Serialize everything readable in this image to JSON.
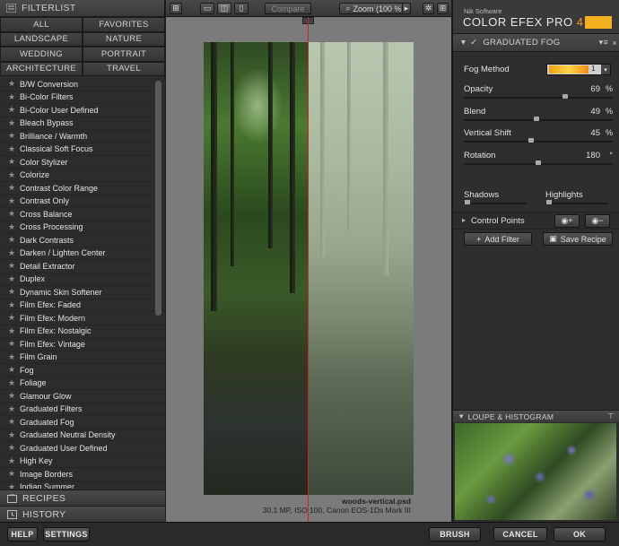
{
  "left_panel": {
    "title": "FILTERLIST",
    "categories": [
      "ALL",
      "FAVORITES",
      "LANDSCAPE",
      "NATURE",
      "WEDDING",
      "PORTRAIT",
      "ARCHITECTURE",
      "TRAVEL"
    ],
    "filters": [
      "B/W Conversion",
      "Bi-Color Filters",
      "Bi-Color User Defined",
      "Bleach Bypass",
      "Brilliance / Warmth",
      "Classical Soft Focus",
      "Color Stylizer",
      "Colorize",
      "Contrast Color Range",
      "Contrast Only",
      "Cross Balance",
      "Cross Processing",
      "Dark Contrasts",
      "Darken / Lighten Center",
      "Detail Extractor",
      "Duplex",
      "Dynamic Skin Softener",
      "Film Efex: Faded",
      "Film Efex: Modern",
      "Film Efex: Nostalgic",
      "Film Efex: Vintage",
      "Film Grain",
      "Fog",
      "Foliage",
      "Glamour Glow",
      "Graduated Filters",
      "Graduated Fog",
      "Graduated Neutral Density",
      "Graduated User Defined",
      "High Key",
      "Image Borders",
      "Indian Summer"
    ],
    "recipes_label": "RECIPES",
    "history_label": "HISTORY"
  },
  "toolbar": {
    "compare_label": "Compare",
    "zoom_label": "Zoom (100 %)"
  },
  "image": {
    "filename": "woods-vertical.psd",
    "info": "30.1 MP, ISO 100, Canon EOS-1Ds Mark III"
  },
  "right_panel": {
    "brand_small": "Nik Software",
    "brand_title": "COLOR EFEX PRO",
    "brand_version": "4",
    "filter_name": "GRADUATED FOG",
    "fog_method_label": "Fog Method",
    "fog_method_value": "1",
    "controls": [
      {
        "label": "Opacity",
        "value": "69",
        "unit": "%",
        "fraction": 0.69
      },
      {
        "label": "Blend",
        "value": "49",
        "unit": "%",
        "fraction": 0.49
      },
      {
        "label": "Vertical Shift",
        "value": "45",
        "unit": "%",
        "fraction": 0.45
      },
      {
        "label": "Rotation",
        "value": "180",
        "unit": "°",
        "fraction": 0.5
      }
    ],
    "shadows_label": "Shadows",
    "highlights_label": "Highlights",
    "control_points_label": "Control Points",
    "add_filter_label": "Add Filter",
    "save_recipe_label": "Save Recipe",
    "loupe_label": "LOUPE & HISTOGRAM"
  },
  "bottom_bar": {
    "help_label": "HELP",
    "settings_label": "SETTINGS",
    "brush_label": "BRUSH",
    "cancel_label": "CANCEL",
    "ok_label": "OK"
  }
}
